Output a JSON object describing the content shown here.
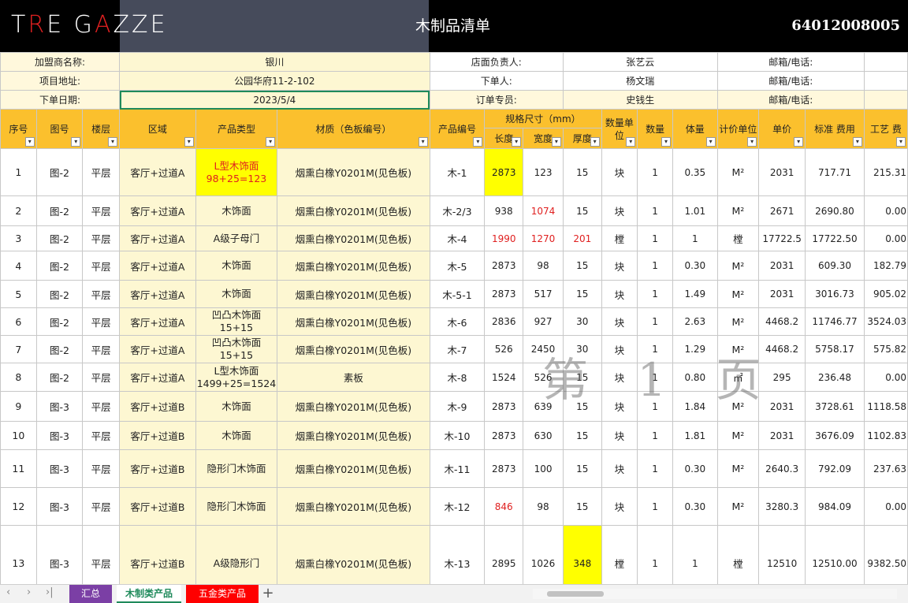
{
  "header": {
    "logo_parts": [
      "T",
      "R",
      "E G",
      "A",
      "ZZE"
    ],
    "title": "木制品清单",
    "order_no": "64012008005"
  },
  "info": {
    "dealer_label": "加盟商名称:",
    "dealer": "银川",
    "store_manager_label": "店面负责人:",
    "store_manager": "张艺云",
    "email1_label": "邮箱/电话:",
    "address_label": "项目地址:",
    "address": "公园华府11-2-102",
    "orderer_label": "下单人:",
    "orderer": "杨文瑞",
    "email2_label": "邮箱/电话:",
    "date_label": "下单日期:",
    "date": "2023/5/4",
    "specialist_label": "订单专员:",
    "specialist": "史钱生",
    "email3_label": "邮箱/电话:"
  },
  "columns": {
    "seq": "序号",
    "drawing": "图号",
    "floor": "楼层",
    "area": "区域",
    "product_type": "产品类型",
    "material": "材质（色板编号）",
    "product_no": "产品编号",
    "spec": "规格尺寸（mm）",
    "length": "长度",
    "width": "宽度",
    "thickness": "厚度",
    "qty_unit": "数量单位",
    "qty": "数量",
    "volume": "体量",
    "calc_unit": "计价单位",
    "unit_price": "单价",
    "std_fee": "标准 费用",
    "craft_fee": "工艺 费"
  },
  "rows": [
    {
      "seq": "1",
      "drawing": "图-2",
      "floor": "平层",
      "area": "客厅+过道A",
      "product_type": "L型木饰面\n98+25=123",
      "material": "烟熏白橡Y0201M(见色板)",
      "product_no": "木-1",
      "length": "2873",
      "width": "123",
      "thickness": "15",
      "qty_unit": "块",
      "qty": "1",
      "volume": "0.35",
      "calc_unit": "M²",
      "unit_price": "2031",
      "std_fee": "717.71",
      "craft_fee": "215.31"
    },
    {
      "seq": "2",
      "drawing": "图-2",
      "floor": "平层",
      "area": "客厅+过道A",
      "product_type": "木饰面",
      "material": "烟熏白橡Y0201M(见色板)",
      "product_no": "木-2/3",
      "length": "938",
      "width": "1074",
      "thickness": "15",
      "qty_unit": "块",
      "qty": "1",
      "volume": "1.01",
      "calc_unit": "M²",
      "unit_price": "2671",
      "std_fee": "2690.80",
      "craft_fee": "0.00"
    },
    {
      "seq": "3",
      "drawing": "图-2",
      "floor": "平层",
      "area": "客厅+过道A",
      "product_type": "A级子母门",
      "material": "烟熏白橡Y0201M(见色板)",
      "product_no": "木-4",
      "length": "1990",
      "width": "1270",
      "thickness": "201",
      "qty_unit": "樘",
      "qty": "1",
      "volume": "1",
      "calc_unit": "樘",
      "unit_price": "17722.5",
      "std_fee": "17722.50",
      "craft_fee": "0.00"
    },
    {
      "seq": "4",
      "drawing": "图-2",
      "floor": "平层",
      "area": "客厅+过道A",
      "product_type": "木饰面",
      "material": "烟熏白橡Y0201M(见色板)",
      "product_no": "木-5",
      "length": "2873",
      "width": "98",
      "thickness": "15",
      "qty_unit": "块",
      "qty": "1",
      "volume": "0.30",
      "calc_unit": "M²",
      "unit_price": "2031",
      "std_fee": "609.30",
      "craft_fee": "182.79"
    },
    {
      "seq": "5",
      "drawing": "图-2",
      "floor": "平层",
      "area": "客厅+过道A",
      "product_type": "木饰面",
      "material": "烟熏白橡Y0201M(见色板)",
      "product_no": "木-5-1",
      "length": "2873",
      "width": "517",
      "thickness": "15",
      "qty_unit": "块",
      "qty": "1",
      "volume": "1.49",
      "calc_unit": "M²",
      "unit_price": "2031",
      "std_fee": "3016.73",
      "craft_fee": "905.02"
    },
    {
      "seq": "6",
      "drawing": "图-2",
      "floor": "平层",
      "area": "客厅+过道A",
      "product_type": "凹凸木饰面\n15+15",
      "material": "烟熏白橡Y0201M(见色板)",
      "product_no": "木-6",
      "length": "2836",
      "width": "927",
      "thickness": "30",
      "qty_unit": "块",
      "qty": "1",
      "volume": "2.63",
      "calc_unit": "M²",
      "unit_price": "4468.2",
      "std_fee": "11746.77",
      "craft_fee": "3524.03"
    },
    {
      "seq": "7",
      "drawing": "图-2",
      "floor": "平层",
      "area": "客厅+过道A",
      "product_type": "凹凸木饰面\n15+15",
      "material": "烟熏白橡Y0201M(见色板)",
      "product_no": "木-7",
      "length": "526",
      "width": "2450",
      "thickness": "30",
      "qty_unit": "块",
      "qty": "1",
      "volume": "1.29",
      "calc_unit": "M²",
      "unit_price": "4468.2",
      "std_fee": "5758.17",
      "craft_fee": "575.82"
    },
    {
      "seq": "8",
      "drawing": "图-2",
      "floor": "平层",
      "area": "客厅+过道A",
      "product_type": "L型木饰面\n1499+25=1524",
      "material": "素板",
      "product_no": "木-8",
      "length": "1524",
      "width": "526",
      "thickness": "15",
      "qty_unit": "块",
      "qty": "1",
      "volume": "0.80",
      "calc_unit": "㎡",
      "unit_price": "295",
      "std_fee": "236.48",
      "craft_fee": "0.00"
    },
    {
      "seq": "9",
      "drawing": "图-3",
      "floor": "平层",
      "area": "客厅+过道B",
      "product_type": "木饰面",
      "material": "烟熏白橡Y0201M(见色板)",
      "product_no": "木-9",
      "length": "2873",
      "width": "639",
      "thickness": "15",
      "qty_unit": "块",
      "qty": "1",
      "volume": "1.84",
      "calc_unit": "M²",
      "unit_price": "2031",
      "std_fee": "3728.61",
      "craft_fee": "1118.58"
    },
    {
      "seq": "10",
      "drawing": "图-3",
      "floor": "平层",
      "area": "客厅+过道B",
      "product_type": "木饰面",
      "material": "烟熏白橡Y0201M(见色板)",
      "product_no": "木-10",
      "length": "2873",
      "width": "630",
      "thickness": "15",
      "qty_unit": "块",
      "qty": "1",
      "volume": "1.81",
      "calc_unit": "M²",
      "unit_price": "2031",
      "std_fee": "3676.09",
      "craft_fee": "1102.83"
    },
    {
      "seq": "11",
      "drawing": "图-3",
      "floor": "平层",
      "area": "客厅+过道B",
      "product_type": "隐形门木饰面",
      "material": "烟熏白橡Y0201M(见色板)",
      "product_no": "木-11",
      "length": "2873",
      "width": "100",
      "thickness": "15",
      "qty_unit": "块",
      "qty": "1",
      "volume": "0.30",
      "calc_unit": "M²",
      "unit_price": "2640.3",
      "std_fee": "792.09",
      "craft_fee": "237.63"
    },
    {
      "seq": "12",
      "drawing": "图-3",
      "floor": "平层",
      "area": "客厅+过道B",
      "product_type": "隐形门木饰面",
      "material": "烟熏白橡Y0201M(见色板)",
      "product_no": "木-12",
      "length": "846",
      "width": "98",
      "thickness": "15",
      "qty_unit": "块",
      "qty": "1",
      "volume": "0.30",
      "calc_unit": "M²",
      "unit_price": "3280.3",
      "std_fee": "984.09",
      "craft_fee": "0.00"
    },
    {
      "seq": "13",
      "drawing": "图-3",
      "floor": "平层",
      "area": "客厅+过道B",
      "product_type": "A级隐形门",
      "material": "烟熏白橡Y0201M(见色板)",
      "product_no": "木-13",
      "length": "2895",
      "width": "1026",
      "thickness": "348",
      "qty_unit": "樘",
      "qty": "1",
      "volume": "1",
      "calc_unit": "樘",
      "unit_price": "12510",
      "std_fee": "12510.00",
      "craft_fee": "9382.50"
    }
  ],
  "watermark": "第 1 页",
  "tabs": {
    "summary": "汇总",
    "wood": "木制类产品",
    "hardware": "五金类产品",
    "add": "+"
  },
  "colors": {
    "header_fill": "#fbc02d",
    "highlight": "#ffff00",
    "active_tab": "#1f8a5b",
    "summary_tab": "#7b3fa5",
    "hardware_tab": "#ff0000"
  }
}
